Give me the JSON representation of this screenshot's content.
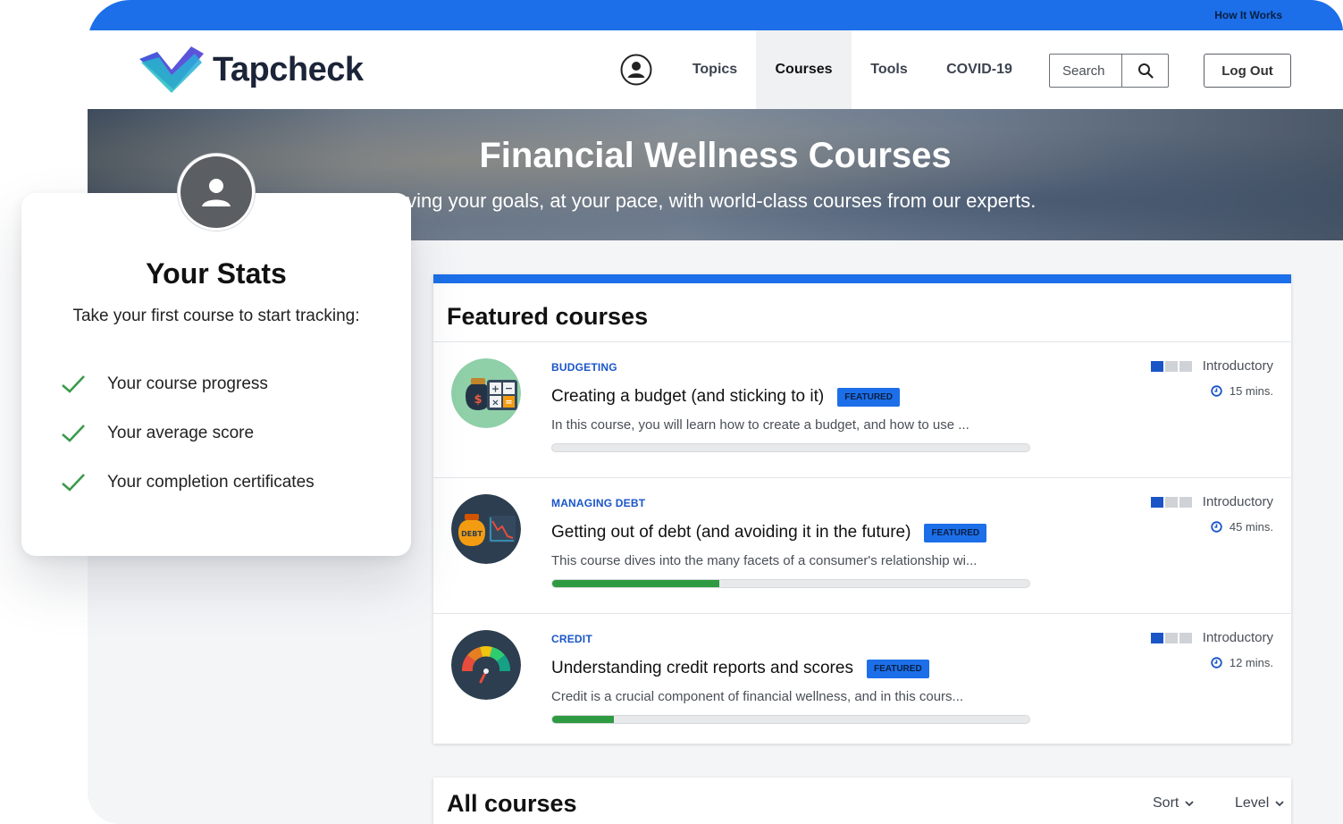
{
  "topbar": {
    "how_it_works": "How It Works"
  },
  "brand": {
    "name": "Tapcheck"
  },
  "nav": {
    "items": [
      {
        "label": "Topics"
      },
      {
        "label": "Courses"
      },
      {
        "label": "Tools"
      },
      {
        "label": "COVID-19"
      }
    ],
    "active": "Courses",
    "search_placeholder": "Search",
    "logout_label": "Log Out"
  },
  "hero": {
    "title": "Financial Wellness Courses",
    "subtitle": "ieving your goals, at your pace, with world-class courses from our experts."
  },
  "featured": {
    "title": "Featured courses",
    "courses": [
      {
        "category": "BUDGETING",
        "title": "Creating a budget (and sticking to it)",
        "badge": "FEATURED",
        "description": "In this course, you will learn how to create a budget, and how to use ...",
        "progress": 0,
        "level": "Introductory",
        "level_filled": 1,
        "duration": "15 mins.",
        "icon": "budget-money-bag-calculator-icon"
      },
      {
        "category": "MANAGING DEBT",
        "title": "Getting out of debt (and avoiding it in the future)",
        "badge": "FEATURED",
        "description": "This course dives into the many facets of a consumer's relationship wi...",
        "progress": 0.35,
        "level": "Introductory",
        "level_filled": 1,
        "duration": "45 mins.",
        "icon": "debt-bag-chart-icon",
        "icon_label": "DEBT"
      },
      {
        "category": "CREDIT",
        "title": "Understanding credit reports and scores",
        "badge": "FEATURED",
        "description": "Credit is a crucial component of financial wellness, and in this cours...",
        "progress": 0.13,
        "level": "Introductory",
        "level_filled": 1,
        "duration": "12 mins.",
        "icon": "credit-score-gauge-icon"
      }
    ]
  },
  "all_courses": {
    "title": "All courses",
    "sort_label": "Sort",
    "level_label": "Level"
  },
  "stats": {
    "title": "Your Stats",
    "subtitle": "Take your first course to start tracking:",
    "items": [
      "Your course progress",
      "Your average score",
      "Your completion certificates"
    ]
  },
  "colors": {
    "accent_blue": "#1c6fe8",
    "category_blue": "#1a55c8",
    "progress_green": "#2e9a42",
    "check_green": "#3a9a4b"
  }
}
